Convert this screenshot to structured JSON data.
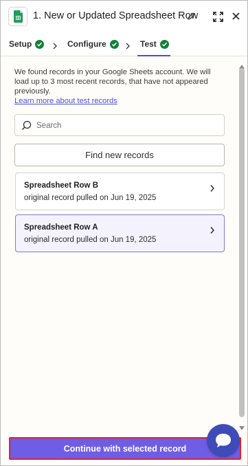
{
  "header": {
    "app_icon": "google-sheets-icon",
    "title": "1. New or Updated Spreadsheet Row",
    "actions": [
      "pencil-icon",
      "expand-icon",
      "close-icon"
    ]
  },
  "tabs": [
    {
      "label": "Setup",
      "status": "complete"
    },
    {
      "label": "Configure",
      "status": "complete"
    },
    {
      "label": "Test",
      "status": "complete",
      "active": true
    }
  ],
  "info": {
    "text": "We found records in your Google Sheets account. We will load up to 3 most recent records, that have not appeared previously.",
    "link": "Learn more about test records"
  },
  "search": {
    "placeholder": "Search",
    "value": ""
  },
  "find_button": "Find new records",
  "records": [
    {
      "title": "Spreadsheet Row B",
      "subtitle": "original record pulled on Jun 19, 2025",
      "selected": false
    },
    {
      "title": "Spreadsheet Row A",
      "subtitle": "original record pulled on Jun 19, 2025",
      "selected": true
    }
  ],
  "continue_button": "Continue with selected record",
  "colors": {
    "accent": "#6f5de5",
    "check": "#13803a",
    "link": "#4a52d9",
    "chat": "#3f4bb8",
    "highlight_border": "#e5212a"
  }
}
